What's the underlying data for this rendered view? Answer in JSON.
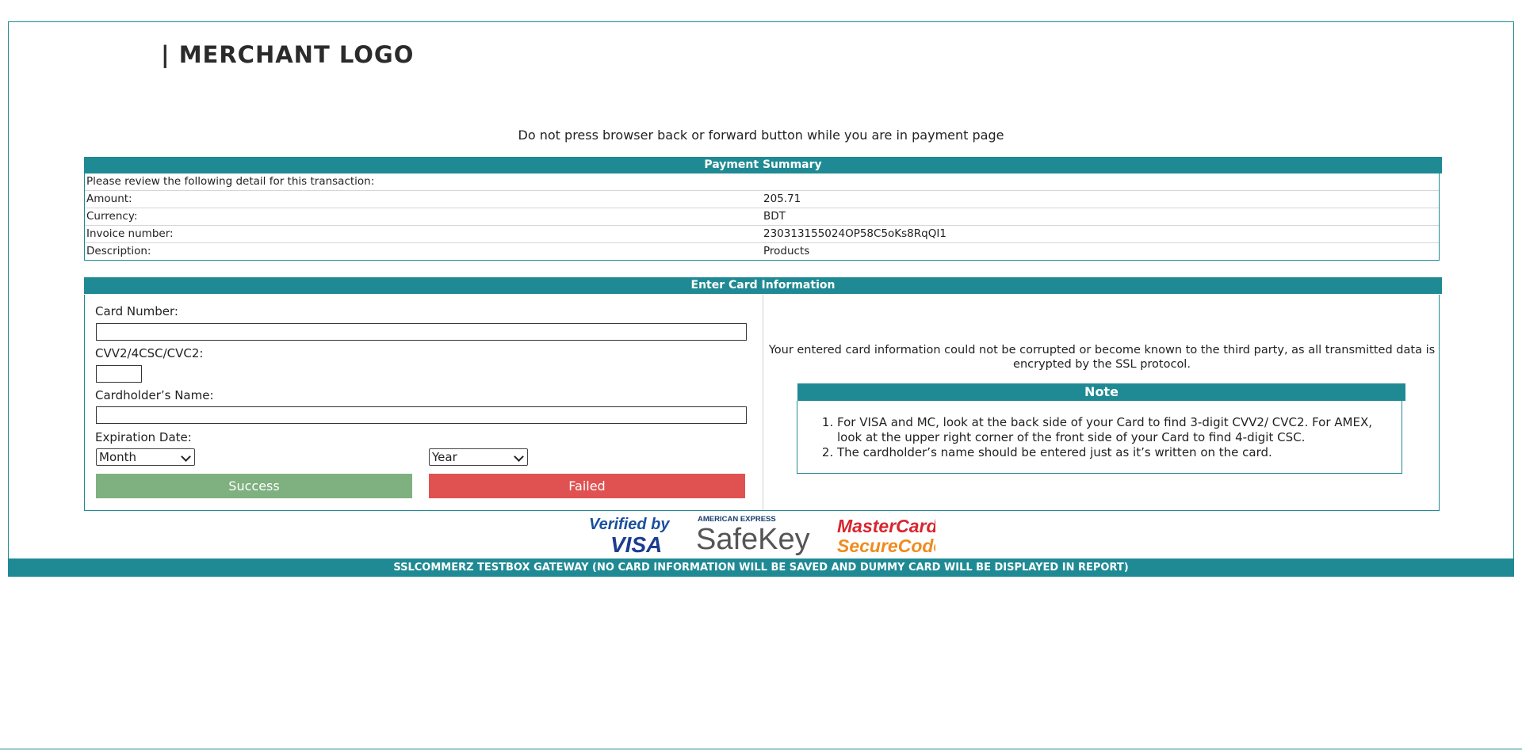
{
  "header": {
    "logo_text": "| MERCHANT LOGO"
  },
  "warning": "Do not press browser back or forward button while you are in payment page",
  "summary": {
    "title": "Payment Summary",
    "intro": "Please review the following detail for this transaction:",
    "rows": [
      {
        "label": "Amount:",
        "value": "205.71"
      },
      {
        "label": "Currency:",
        "value": "BDT"
      },
      {
        "label": "Invoice number:",
        "value": "230313155024OP58C5oKs8RqQI1"
      },
      {
        "label": "Description:",
        "value": "Products"
      }
    ]
  },
  "card": {
    "title": "Enter Card Information",
    "card_number_label": "Card Number:",
    "card_number_value": "",
    "cvv_label": "CVV2/4CSC/CVC2:",
    "cvv_value": "",
    "holder_label": "Cardholder’s Name:",
    "holder_value": "",
    "expiry_label": "Expiration Date:",
    "month_selected": "Month",
    "year_selected": "Year",
    "success_label": "Success",
    "failed_label": "Failed",
    "secure_text": "Your entered card information could not be corrupted or become known to the third party, as all transmitted data is encrypted by the SSL protocol."
  },
  "note": {
    "title": "Note",
    "items": [
      "For VISA and MC, look at the back side of your Card to find 3-digit CVV2/ CVC2. For AMEX, look at the upper right corner of the front side of your Card to find 4-digit CSC.",
      "The cardholder’s name should be entered just as it’s written on the card."
    ]
  },
  "badges": {
    "visa_line1": "Verified by",
    "visa_line2": "VISA",
    "amex_top": "AMERICAN EXPRESS",
    "amex_main": "SafeKey",
    "mc_line1": "MasterCard.",
    "mc_line2": "SecureCode."
  },
  "footer": "SSLCOMMERZ TESTBOX GATEWAY (NO CARD INFORMATION WILL BE SAVED AND DUMMY CARD WILL BE DISPLAYED IN REPORT)",
  "colors": {
    "accent": "#1f8a94",
    "success": "#7fb07f",
    "failed": "#e05252"
  }
}
